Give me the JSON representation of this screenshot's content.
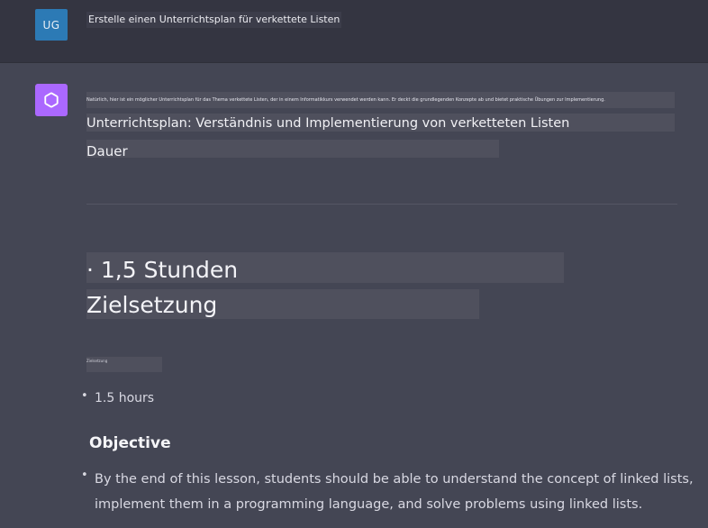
{
  "user": {
    "avatar_initials": "UG",
    "message": "Erstelle einen Unterrichtsplan für verkettete Listen"
  },
  "assistant": {
    "avatar_icon": "openai-logo-icon",
    "intro_tiny": "Natürlich, hier ist ein möglicher Unterrichtsplan für das Thema verkettete Listen, der in einem Informatikkurs verwendet werden kann. Er deckt die grundlegenden Konzepte ab und bietet praktische Übungen zur Implementierung.",
    "plan_title": "Unterrichtsplan: Verständnis und Implementierung von verketteten Listen",
    "duration_label": "Dauer",
    "hours_big": "· 1,5 Stunden",
    "objective_big": "Zielsetzung",
    "small_label": "Zielsetzung",
    "english": {
      "hours": "1.5 hours",
      "objective_heading": "Objective",
      "objective_text": "By the end of this lesson, students should be able to understand the concept of linked lists, implement them in a programming language, and solve problems using linked lists."
    }
  },
  "colors": {
    "background": "#444654",
    "user_row": "#343541",
    "user_avatar": "#2c7ab5",
    "assistant_avatar": "#ab68ff"
  }
}
